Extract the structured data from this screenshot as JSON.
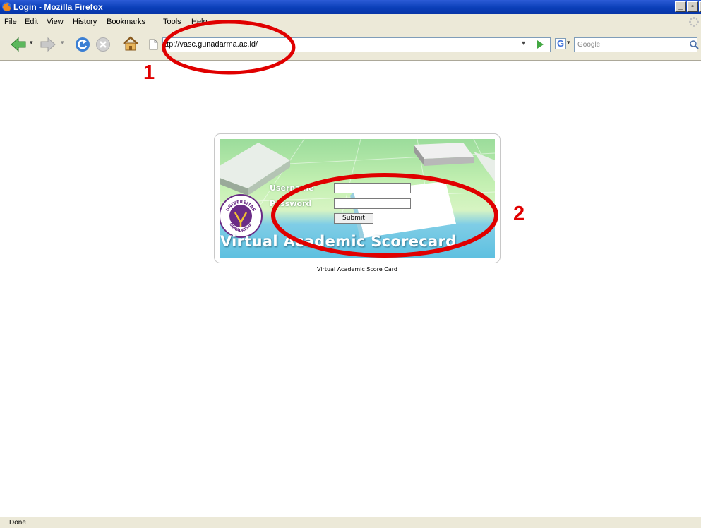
{
  "window": {
    "title": "Login - Mozilla Firefox"
  },
  "menu": [
    "File",
    "Edit",
    "View",
    "History",
    "Bookmarks",
    "Tools",
    "Help"
  ],
  "address_bar": {
    "url": "http://vasc.gunadarma.ac.id/",
    "visible_text": "ttp://vasc.gunadarma.ac.id/"
  },
  "search": {
    "placeholder": "Google"
  },
  "login": {
    "username_label": "Username",
    "password_label": "Password",
    "submit_label": "Submit",
    "banner_title": "Virtual Academic Scorecard",
    "caption": "Virtual Academic Score Card",
    "logo_text_top": "UNIVERSITAS",
    "logo_text_bottom": "GUNADARMA"
  },
  "annotations": {
    "marker_1": "1",
    "marker_2": "2",
    "color": "#e00000"
  },
  "status": {
    "text": "Done"
  },
  "colors": {
    "titlebar": "#0a3fb8",
    "chrome": "#ece9d8",
    "logo_purple": "#6a2c86",
    "banner_green": "#9bdc9b",
    "banner_blue": "#5ec0e0"
  }
}
